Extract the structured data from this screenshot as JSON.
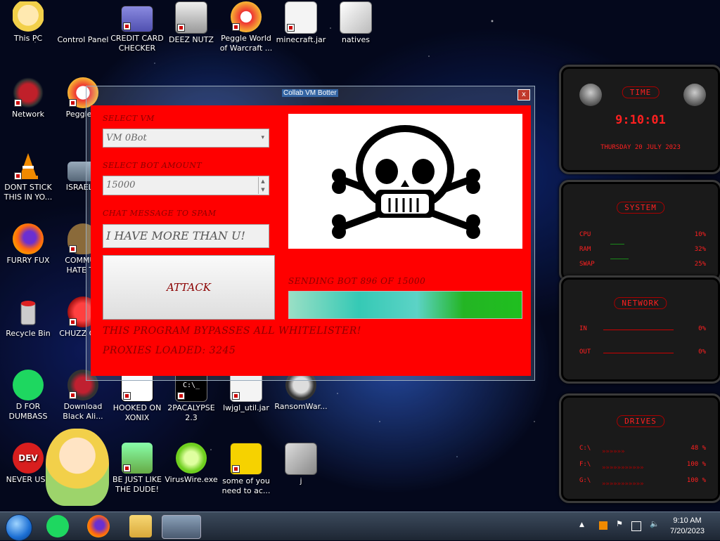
{
  "desktop_icons": [
    {
      "label": "This PC"
    },
    {
      "label": "Control Panel"
    },
    {
      "label": "CREDIT CARD CHECKER"
    },
    {
      "label": "DEEZ NUTZ"
    },
    {
      "label": "Peggle World of Warcraft ..."
    },
    {
      "label": "minecraft.jar"
    },
    {
      "label": "natives"
    },
    {
      "label": "Network"
    },
    {
      "label": "Peggle D"
    },
    {
      "label": "DONT STICK THIS IN YO..."
    },
    {
      "label": "ISRAEL S"
    },
    {
      "label": "FURRY FUX"
    },
    {
      "label": "COMMUN HATE TH"
    },
    {
      "label": "Recycle Bin"
    },
    {
      "label": "CHUZZ CUM"
    },
    {
      "label": "D FOR DUMBASS"
    },
    {
      "label": "Download Black Ali..."
    },
    {
      "label": "HOOKED ON XONIX"
    },
    {
      "label": "2PACALYPSE 2.3"
    },
    {
      "label": "lwjgl_util.jar"
    },
    {
      "label": "RansomWar..."
    },
    {
      "label": "NEVER USE"
    },
    {
      "label": "BE JUST LIKE THE DUDE!"
    },
    {
      "label": "VirusWire.exe"
    },
    {
      "label": "some of you need to ac..."
    },
    {
      "label": "j"
    }
  ],
  "app": {
    "title": "Collab VM Botter",
    "close_glyph": "x",
    "select_vm_label": "SELECT VM",
    "vm_value": "VM 0Bot",
    "bot_amount_label": "SELECT BOT AMOUNT",
    "bot_amount_value": "15000",
    "chat_label": "CHAT MESSAGE TO SPAM",
    "chat_value": "I HAVE MORE THAN U!",
    "attack_label": "ATTACK",
    "status_text": "SENDING BOT 896 OF 15000",
    "progress": 1.0,
    "bypass_text": "THIS PROGRAM BYPASSES ALL WHITELISTER!",
    "proxies_text": "PROXIES LOADED: 3245",
    "colors": {
      "panel": "#ff0000",
      "text": "#8b0000"
    }
  },
  "widgets": {
    "time": {
      "title": "TIME",
      "clock": "9:10:01",
      "date": "THURSDAY 20 JULY 2023"
    },
    "system": {
      "title": "SYSTEM",
      "rows": [
        {
          "label": "CPU",
          "value": "10%"
        },
        {
          "label": "RAM",
          "value": "32%"
        },
        {
          "label": "SWAP",
          "value": "25%"
        }
      ]
    },
    "network": {
      "title": "NETWORK",
      "rows": [
        {
          "label": "IN",
          "value": "0%"
        },
        {
          "label": "OUT",
          "value": "0%"
        }
      ]
    },
    "drives": {
      "title": "DRIVES",
      "rows": [
        {
          "label": "C:\\",
          "value": "48 %"
        },
        {
          "label": "F:\\",
          "value": "100 %"
        },
        {
          "label": "G:\\",
          "value": "100 %"
        }
      ]
    }
  },
  "taskbar": {
    "time": "9:10 AM",
    "date": "7/20/2023"
  }
}
